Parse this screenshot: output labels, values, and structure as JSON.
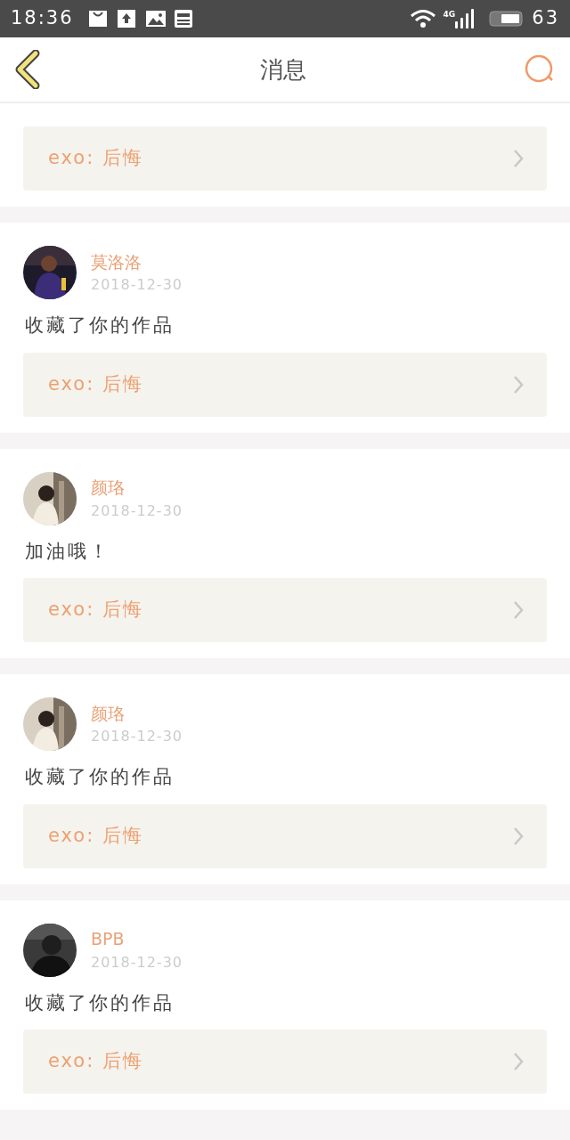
{
  "status_bar": {
    "time": "18:36",
    "network": "4G",
    "battery": "63"
  },
  "header": {
    "title": "消息"
  },
  "messages": [
    {
      "work": "exo: 后悔"
    },
    {
      "user": "莫洛洛",
      "date": "2018-12-30",
      "text": "收藏了你的作品",
      "work": "exo: 后悔"
    },
    {
      "user": "颜珞",
      "date": "2018-12-30",
      "text": "加油哦！",
      "work": "exo: 后悔"
    },
    {
      "user": "颜珞",
      "date": "2018-12-30",
      "text": "收藏了你的作品",
      "work": "exo: 后悔"
    },
    {
      "user": "BPB",
      "date": "2018-12-30",
      "text": "收藏了你的作品",
      "work": "exo: 后悔"
    }
  ]
}
